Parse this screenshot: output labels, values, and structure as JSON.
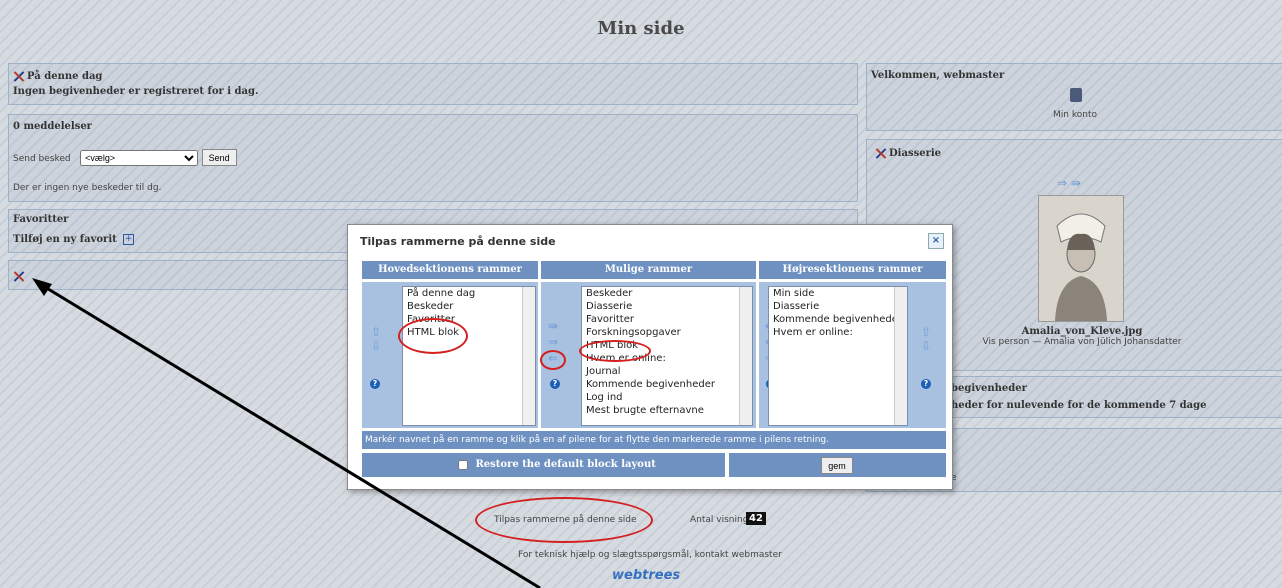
{
  "page": {
    "title": "Min side"
  },
  "on_this_day": {
    "title": "På denne dag",
    "text": "Ingen begivenheder er registreret for i dag."
  },
  "messages": {
    "title": "0 meddelelser",
    "send_label": "Send besked",
    "select_value": "<vælg>",
    "send_button": "Send",
    "no_messages": "Der er ingen nye beskeder til dg."
  },
  "favorites": {
    "title": "Favoritter",
    "add": "Tilføj en ny favorit"
  },
  "welcome": {
    "title": "Velkommen, webmaster",
    "account": "Min konto"
  },
  "slideshow": {
    "title": "Diasserie",
    "arrows": "⇒ ⇛",
    "filename": "Amalia_von_Kleve.jpg",
    "caption": "Vis person — Amalia von Jülich Johansdatter"
  },
  "events": {
    "title_partial": "begivenheder",
    "text_partial": "heder for nulevende for de kommende 7 dage"
  },
  "right_extra": {
    "text_partial": "e"
  },
  "dialog": {
    "title": "Tilpas rammerne på denne side",
    "close": "×",
    "col_main": "Hovedsektionens rammer",
    "col_possible": "Mulige rammer",
    "col_right": "Højresektionens rammer",
    "main_items": [
      "På denne dag",
      "Beskeder",
      "Favoritter",
      "HTML blok"
    ],
    "possible_items": [
      "Beskeder",
      "Diasserie",
      "Favoritter",
      "Forskningsopgaver",
      "HTML blok",
      "Hvem er online:",
      "Journal",
      "Kommende begivenheder",
      "Log ind",
      "Mest brugte efternavne"
    ],
    "right_items": [
      "Min side",
      "Diasserie",
      "Kommende begivenheder",
      "Hvem er online:"
    ],
    "note": "Markér navnet på en ramme og klik på en af pilene for at flytte den markerede ramme i pilens retning.",
    "restore": "Restore the default block layout",
    "save": "gem"
  },
  "footer": {
    "customize": "Tilpas rammerne på denne side",
    "views_label": "Antal visninger:",
    "views_count": "42",
    "contact": "For teknisk hjælp og slægtsspørgsmål, kontakt",
    "contact_link": "webmaster",
    "brand": "webtrees"
  },
  "colors": {
    "header_blue": "#6e91c2",
    "lane_blue": "#a9c1e0",
    "annotation_red": "#d42020"
  }
}
